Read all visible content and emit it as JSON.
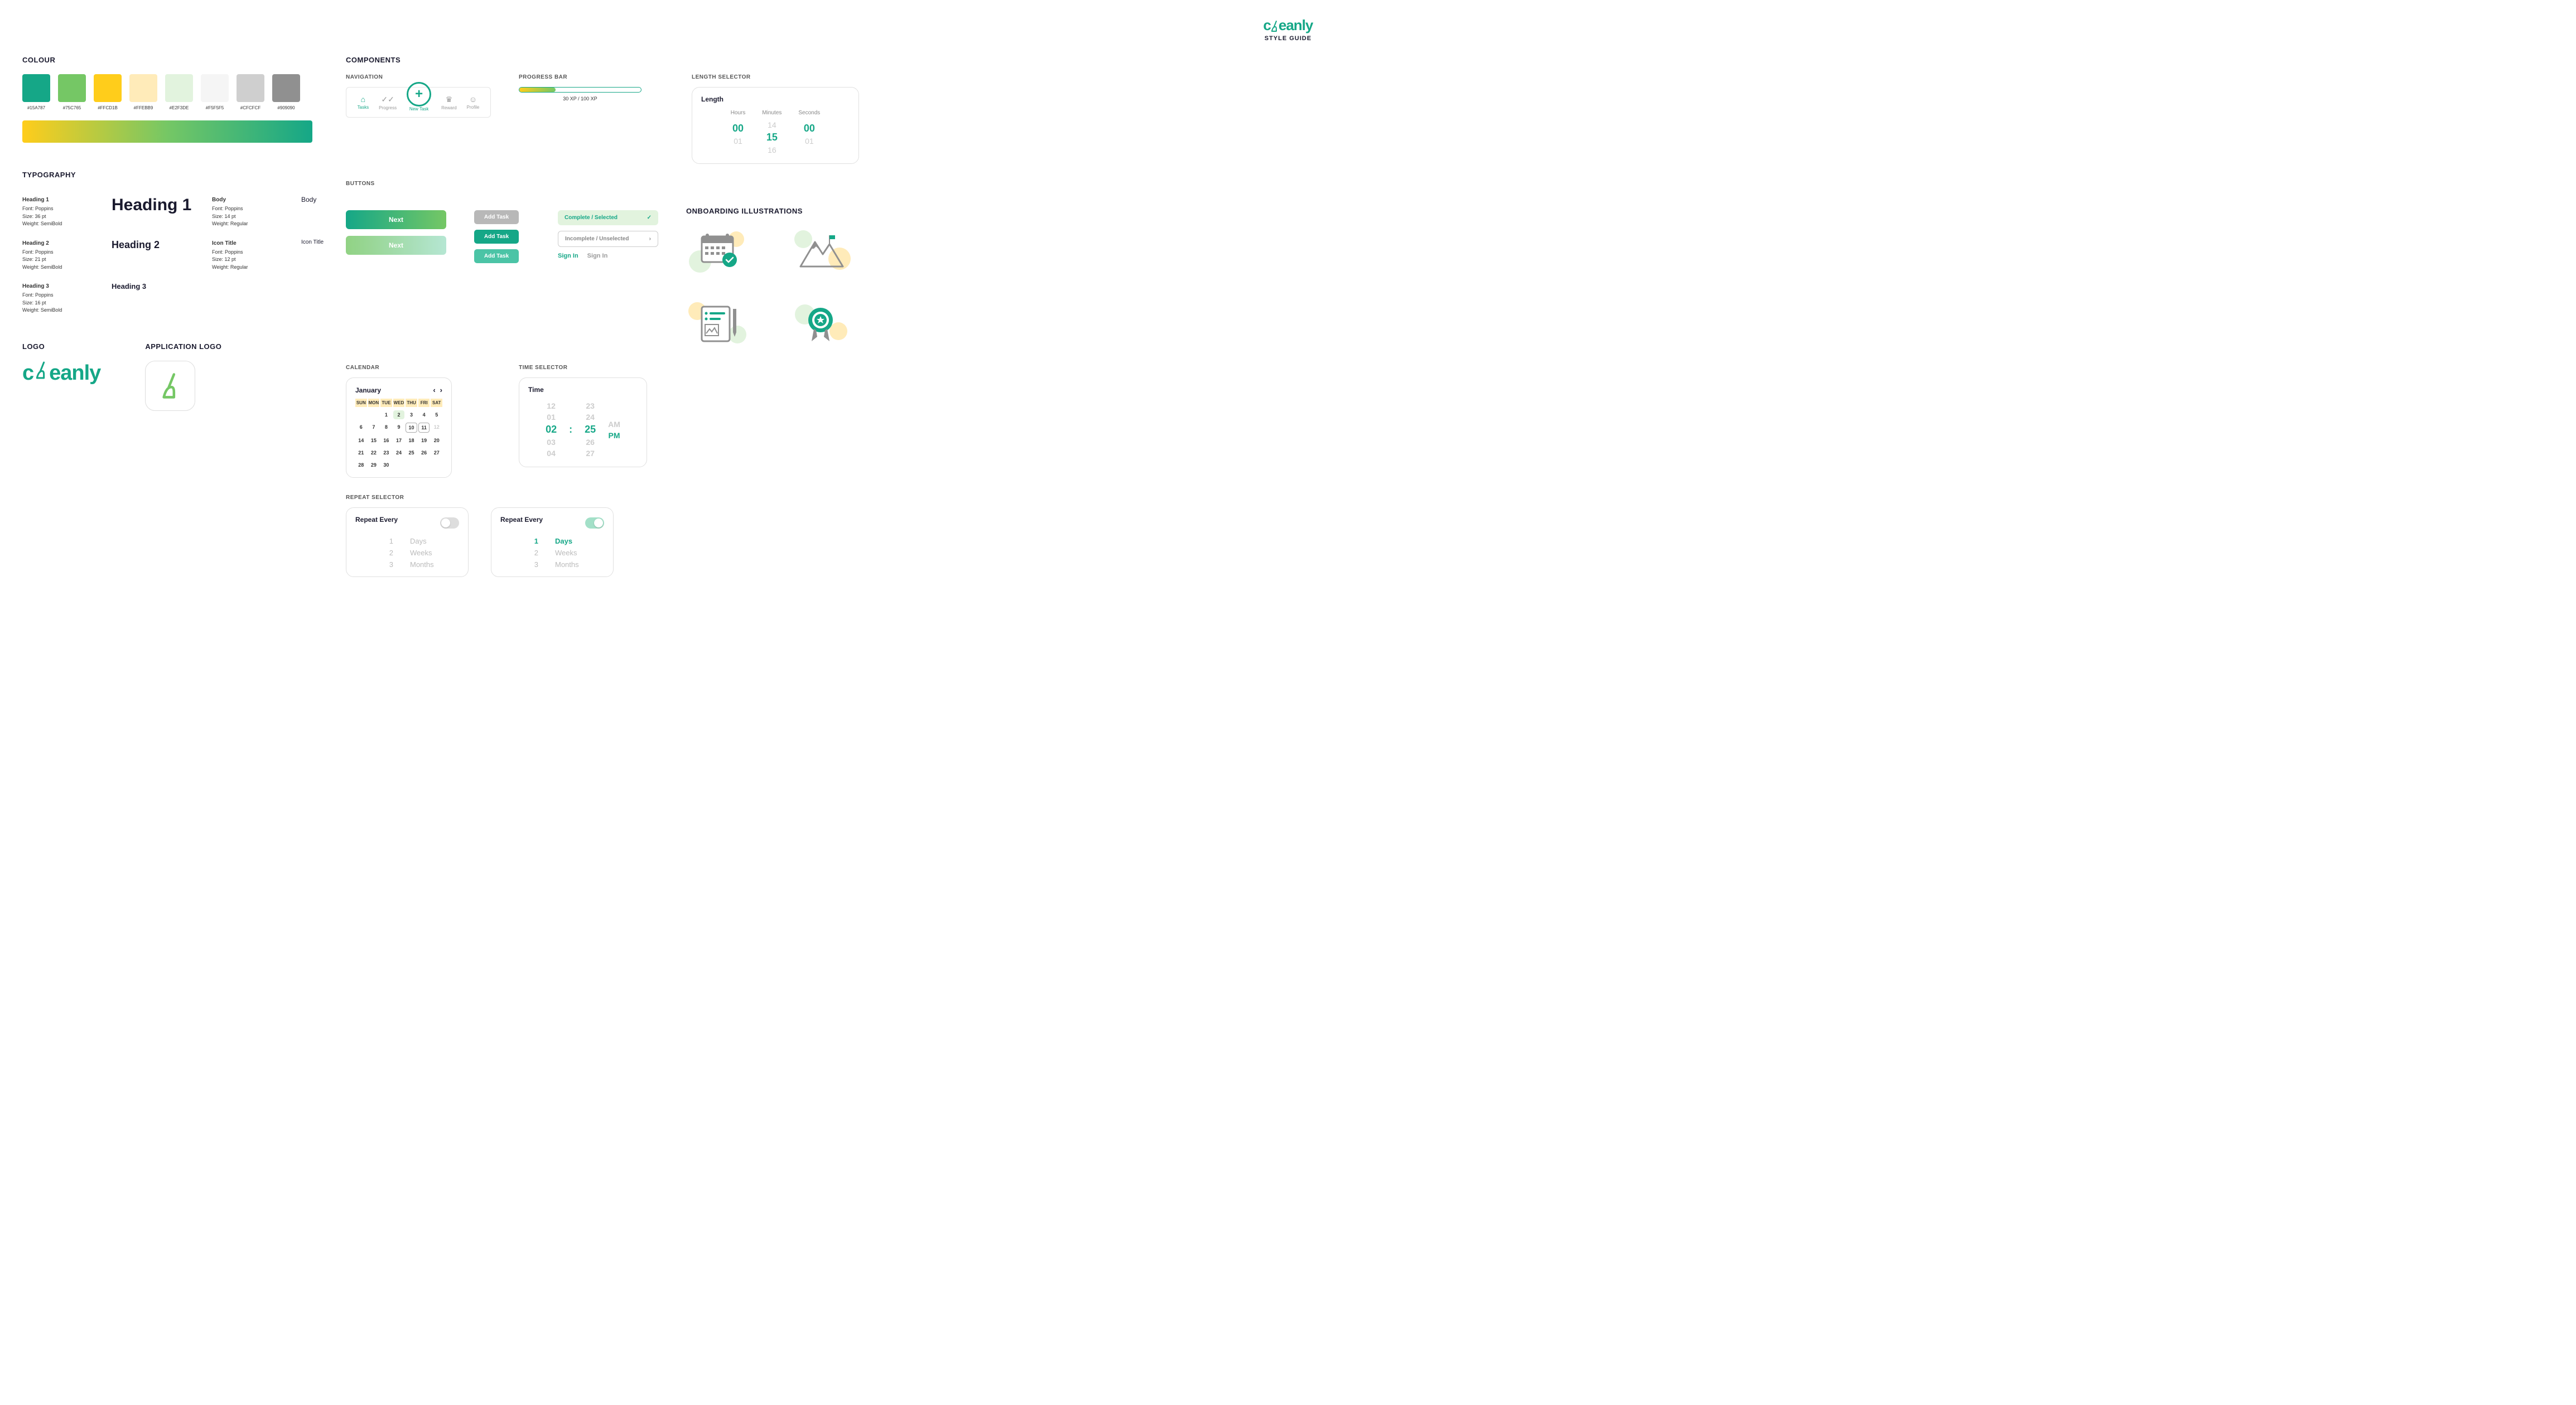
{
  "brand": {
    "name": "cleanly",
    "subtitle": "STYLE GUIDE"
  },
  "sections": {
    "colour": "COLOUR",
    "typography": "TYPOGRAPHY",
    "logo": "LOGO",
    "appLogo": "APPLICATION LOGO",
    "components": "COMPONENTS",
    "navigation": "NAVIGATION",
    "progressBar": "PROGRESS BAR",
    "lengthSelector": "LENGTH SELECTOR",
    "buttons": "BUTTONS",
    "calendar": "CALENDAR",
    "timeSelector": "TIME SELECTOR",
    "repeatSelector": "REPEAT SELECTOR",
    "onboarding": "ONBOARDING ILLUSTRATIONS"
  },
  "colours": [
    {
      "hex": "#15A787"
    },
    {
      "hex": "#75C765"
    },
    {
      "hex": "#FFCD1B"
    },
    {
      "hex": "#FFEBB9"
    },
    {
      "hex": "#E2F3DE"
    },
    {
      "hex": "#F5F5F5"
    },
    {
      "hex": "#CFCFCF"
    },
    {
      "hex": "#909090"
    }
  ],
  "typography": [
    {
      "name": "Heading 1",
      "font": "Font: Poppins",
      "size": "Size: 36 pt",
      "weight": "Weight: SemiBold",
      "sample": "Heading 1",
      "cls": "sample-h1"
    },
    {
      "name": "Heading 2",
      "font": "Font: Poppins",
      "size": "Size: 21 pt",
      "weight": "Weight: SemiBold",
      "sample": "Heading 2",
      "cls": "sample-h2"
    },
    {
      "name": "Heading 3",
      "font": "Font: Poppins",
      "size": "Size: 16 pt",
      "weight": "Weight: SemiBold",
      "sample": "Heading 3",
      "cls": "sample-h3"
    },
    {
      "name": "Body",
      "font": "Font: Poppins",
      "size": "Size: 14 pt",
      "weight": "Weight: Regular",
      "sample": "Body",
      "cls": "sample-body"
    },
    {
      "name": "Icon Title",
      "font": "Font: Poppins",
      "size": "Size: 12 pt",
      "weight": "Weight: Regular",
      "sample": "Icon Title",
      "cls": "sample-icon-title"
    }
  ],
  "nav": {
    "items": [
      "Tasks",
      "Progress",
      "New Task",
      "Reward",
      "Profile"
    ]
  },
  "progress": {
    "label": "30 XP / 100 XP"
  },
  "buttons": {
    "next": "Next",
    "addTask": "Add Task",
    "selected": "Complete / Selected",
    "unselected": "Incomplete / Unselected",
    "signIn": "Sign In"
  },
  "calendar": {
    "month": "January",
    "dow": [
      "SUN",
      "MON",
      "TUE",
      "WED",
      "THU",
      "FRI",
      "SAT"
    ],
    "rows": [
      [
        "",
        "",
        "1",
        "2",
        "3",
        "4",
        "5"
      ],
      [
        "6",
        "7",
        "8",
        "9",
        "10",
        "11",
        "12"
      ],
      [
        "14",
        "15",
        "16",
        "17",
        "18",
        "19",
        "20"
      ],
      [
        "21",
        "22",
        "23",
        "24",
        "25",
        "26",
        "27"
      ],
      [
        "28",
        "29",
        "30",
        "",
        "",
        " ",
        " "
      ]
    ]
  },
  "time": {
    "title": "Time",
    "h": [
      "12",
      "01",
      "02",
      "03",
      "04"
    ],
    "m": [
      "23",
      "24",
      "25",
      "26",
      "27"
    ],
    "ampm": [
      "AM",
      "PM"
    ]
  },
  "length": {
    "title": "Length",
    "labels": [
      "Hours",
      "Minutes",
      "Seconds"
    ],
    "hours": [
      "",
      "00",
      "01"
    ],
    "minutes": [
      "14",
      "15",
      "16"
    ],
    "seconds": [
      "",
      "00",
      "01"
    ]
  },
  "repeat": {
    "title": "Repeat Every",
    "nums": [
      "1",
      "2",
      "3"
    ],
    "units": [
      "Days",
      "Weeks",
      "Months"
    ]
  }
}
